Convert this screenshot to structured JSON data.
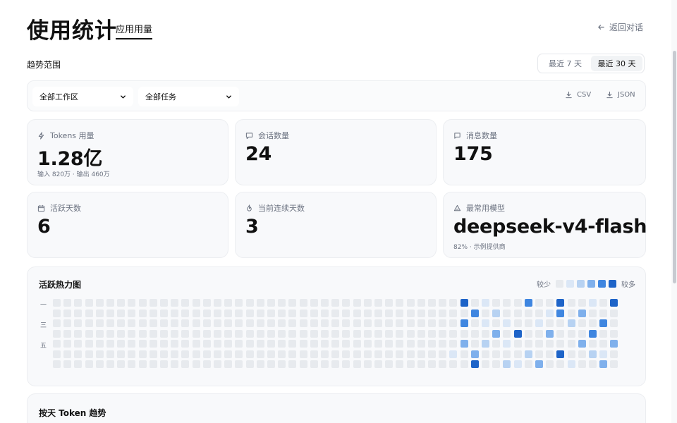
{
  "header": {
    "title": "使用统计",
    "tab": "应用用量",
    "back": "返回对话"
  },
  "range": {
    "label": "趋势范围",
    "options": [
      "最近 7 天",
      "最近 30 天"
    ],
    "selected": "最近 30 天"
  },
  "filters": {
    "workspace": "全部工作区",
    "task": "全部任务",
    "export_csv": "CSV",
    "export_json": "JSON"
  },
  "cards": [
    {
      "label": "Tokens 用量",
      "icon": "bolt-icon",
      "value": "1.28亿",
      "sub": "输入 820万 · 输出 460万"
    },
    {
      "label": "会话数量",
      "icon": "chat-icon",
      "value": "24",
      "sub": ""
    },
    {
      "label": "消息数量",
      "icon": "message-icon",
      "value": "175",
      "sub": ""
    },
    {
      "label": "活跃天数",
      "icon": "calendar-icon",
      "value": "6",
      "sub": ""
    },
    {
      "label": "当前连续天数",
      "icon": "flame-icon",
      "value": "3",
      "sub": ""
    },
    {
      "label": "最常用模型",
      "icon": "model-icon",
      "value": "deepseek-v4-flash",
      "sub": "82% · 示例提供商"
    }
  ],
  "heatmap": {
    "title": "活跃热力图",
    "legend_less": "较少",
    "legend_more": "较多",
    "row_labels": [
      "一",
      "三",
      "五"
    ],
    "colors": [
      "#e7eaee",
      "#dbe7f6",
      "#b7d2f2",
      "#7fb0ec",
      "#3f86e0",
      "#1e64c8"
    ],
    "weeks": 53,
    "active_cells": [
      {
        "week": 38,
        "day": 0,
        "level": 5
      },
      {
        "week": 39,
        "day": 1,
        "level": 4
      },
      {
        "week": 41,
        "day": 1,
        "level": 2
      },
      {
        "week": 38,
        "day": 2,
        "level": 4
      },
      {
        "week": 40,
        "day": 2,
        "level": 1
      },
      {
        "week": 41,
        "day": 3,
        "level": 3
      },
      {
        "week": 42,
        "day": 2,
        "level": 1
      },
      {
        "week": 43,
        "day": 3,
        "level": 5
      },
      {
        "week": 44,
        "day": 0,
        "level": 4
      },
      {
        "week": 45,
        "day": 2,
        "level": 1
      },
      {
        "week": 46,
        "day": 3,
        "level": 3
      },
      {
        "week": 47,
        "day": 0,
        "level": 5
      },
      {
        "week": 47,
        "day": 1,
        "level": 4
      },
      {
        "week": 48,
        "day": 2,
        "level": 2
      },
      {
        "week": 49,
        "day": 1,
        "level": 3
      },
      {
        "week": 50,
        "day": 3,
        "level": 4
      },
      {
        "week": 51,
        "day": 2,
        "level": 4
      },
      {
        "week": 52,
        "day": 0,
        "level": 5
      },
      {
        "week": 38,
        "day": 4,
        "level": 3
      },
      {
        "week": 39,
        "day": 5,
        "level": 3
      },
      {
        "week": 40,
        "day": 4,
        "level": 2
      },
      {
        "week": 42,
        "day": 6,
        "level": 2
      },
      {
        "week": 44,
        "day": 5,
        "level": 2
      },
      {
        "week": 45,
        "day": 6,
        "level": 3
      },
      {
        "week": 47,
        "day": 5,
        "level": 5
      },
      {
        "week": 49,
        "day": 4,
        "level": 3
      },
      {
        "week": 50,
        "day": 5,
        "level": 2
      },
      {
        "week": 51,
        "day": 6,
        "level": 3
      },
      {
        "week": 52,
        "day": 4,
        "level": 3
      },
      {
        "week": 39,
        "day": 6,
        "level": 5
      },
      {
        "week": 42,
        "day": 4,
        "level": 1
      },
      {
        "week": 48,
        "day": 6,
        "level": 1
      },
      {
        "week": 46,
        "day": 1,
        "level": 1
      },
      {
        "week": 40,
        "day": 0,
        "level": 1
      },
      {
        "week": 50,
        "day": 0,
        "level": 1
      },
      {
        "week": 43,
        "day": 6,
        "level": 1
      },
      {
        "week": 37,
        "day": 5,
        "level": 1
      },
      {
        "week": 51,
        "day": 5,
        "level": 1
      }
    ]
  },
  "trend": {
    "title": "按天 Token 趋势"
  }
}
